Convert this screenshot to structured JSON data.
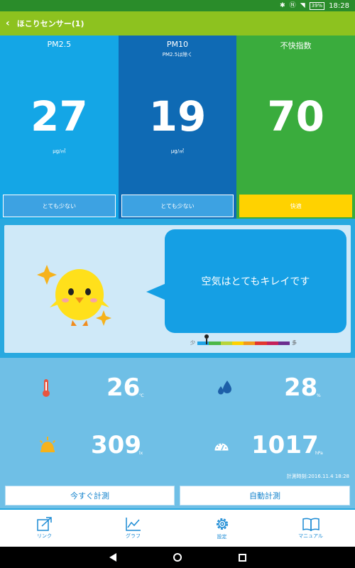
{
  "status_bar": {
    "battery": "39%",
    "time": "18:28"
  },
  "app_bar": {
    "title": "ほこりセンサー(1)"
  },
  "panels": [
    {
      "title": "PM2.5",
      "subtitle": "",
      "value": "27",
      "unit": "μg/㎥",
      "status": "とても少ない",
      "color": "#14a6e6"
    },
    {
      "title": "PM10",
      "subtitle": "PM2.5は除く",
      "value": "19",
      "unit": "μg/㎥",
      "status": "とても少ない",
      "color": "#0f6ab4"
    },
    {
      "title": "不快指数",
      "subtitle": "",
      "value": "70",
      "unit": "",
      "status": "快適",
      "color": "#3aac3d"
    }
  ],
  "message": {
    "text": "空気はとてもキレイです",
    "scale_low": "少",
    "scale_high": "多",
    "scale_colors": [
      "#1ea3e5",
      "#4cb848",
      "#b8d43a",
      "#ffd200",
      "#f29a1b",
      "#e2362e",
      "#c4205a",
      "#6b2d8f"
    ],
    "scale_level": 0.1
  },
  "stats": {
    "temperature": {
      "value": "26",
      "unit": "℃"
    },
    "humidity": {
      "value": "28",
      "unit": "%"
    },
    "illuminance": {
      "value": "309",
      "unit": "lx"
    },
    "pressure": {
      "value": "1017",
      "unit": "hPa"
    }
  },
  "measured_time": "計測時刻:2016.11.4 18:28",
  "buttons": {
    "measure_now": "今すぐ計測",
    "auto_measure": "自動計測"
  },
  "nav": [
    {
      "label": "リンク",
      "icon": "link-out-icon"
    },
    {
      "label": "グラフ",
      "icon": "graph-icon"
    },
    {
      "label": "設定",
      "icon": "gear-icon"
    },
    {
      "label": "マニュアル",
      "icon": "book-icon"
    }
  ],
  "colors": {
    "app_bar": "#8dc21f",
    "status_bar": "#2a8c2a",
    "comfortable": "#ffd200",
    "accent": "#1a8ad4"
  }
}
